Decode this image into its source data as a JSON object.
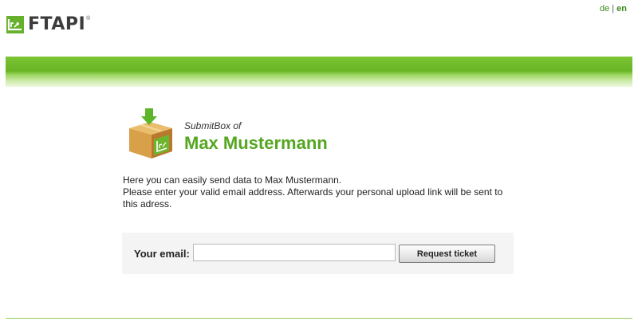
{
  "language": {
    "options": [
      "de",
      "en"
    ],
    "active": "en",
    "separator": "|"
  },
  "brand": {
    "name": "FTAPI",
    "registered_mark": "®",
    "logo_icon": "ftapi-logo-icon",
    "accent_color": "#55a620"
  },
  "submitbox": {
    "label": "SubmitBox of",
    "owner_name": "Max Mustermann",
    "icon": "submit-box-icon"
  },
  "intro": {
    "line1": "Here you can easily send data to Max Mustermann.",
    "line2": "Please enter your valid email address. Afterwards your personal upload link will be sent to this adress."
  },
  "form": {
    "email_label": "Your email:",
    "email_value": "",
    "email_placeholder": "",
    "submit_label": "Request ticket"
  }
}
